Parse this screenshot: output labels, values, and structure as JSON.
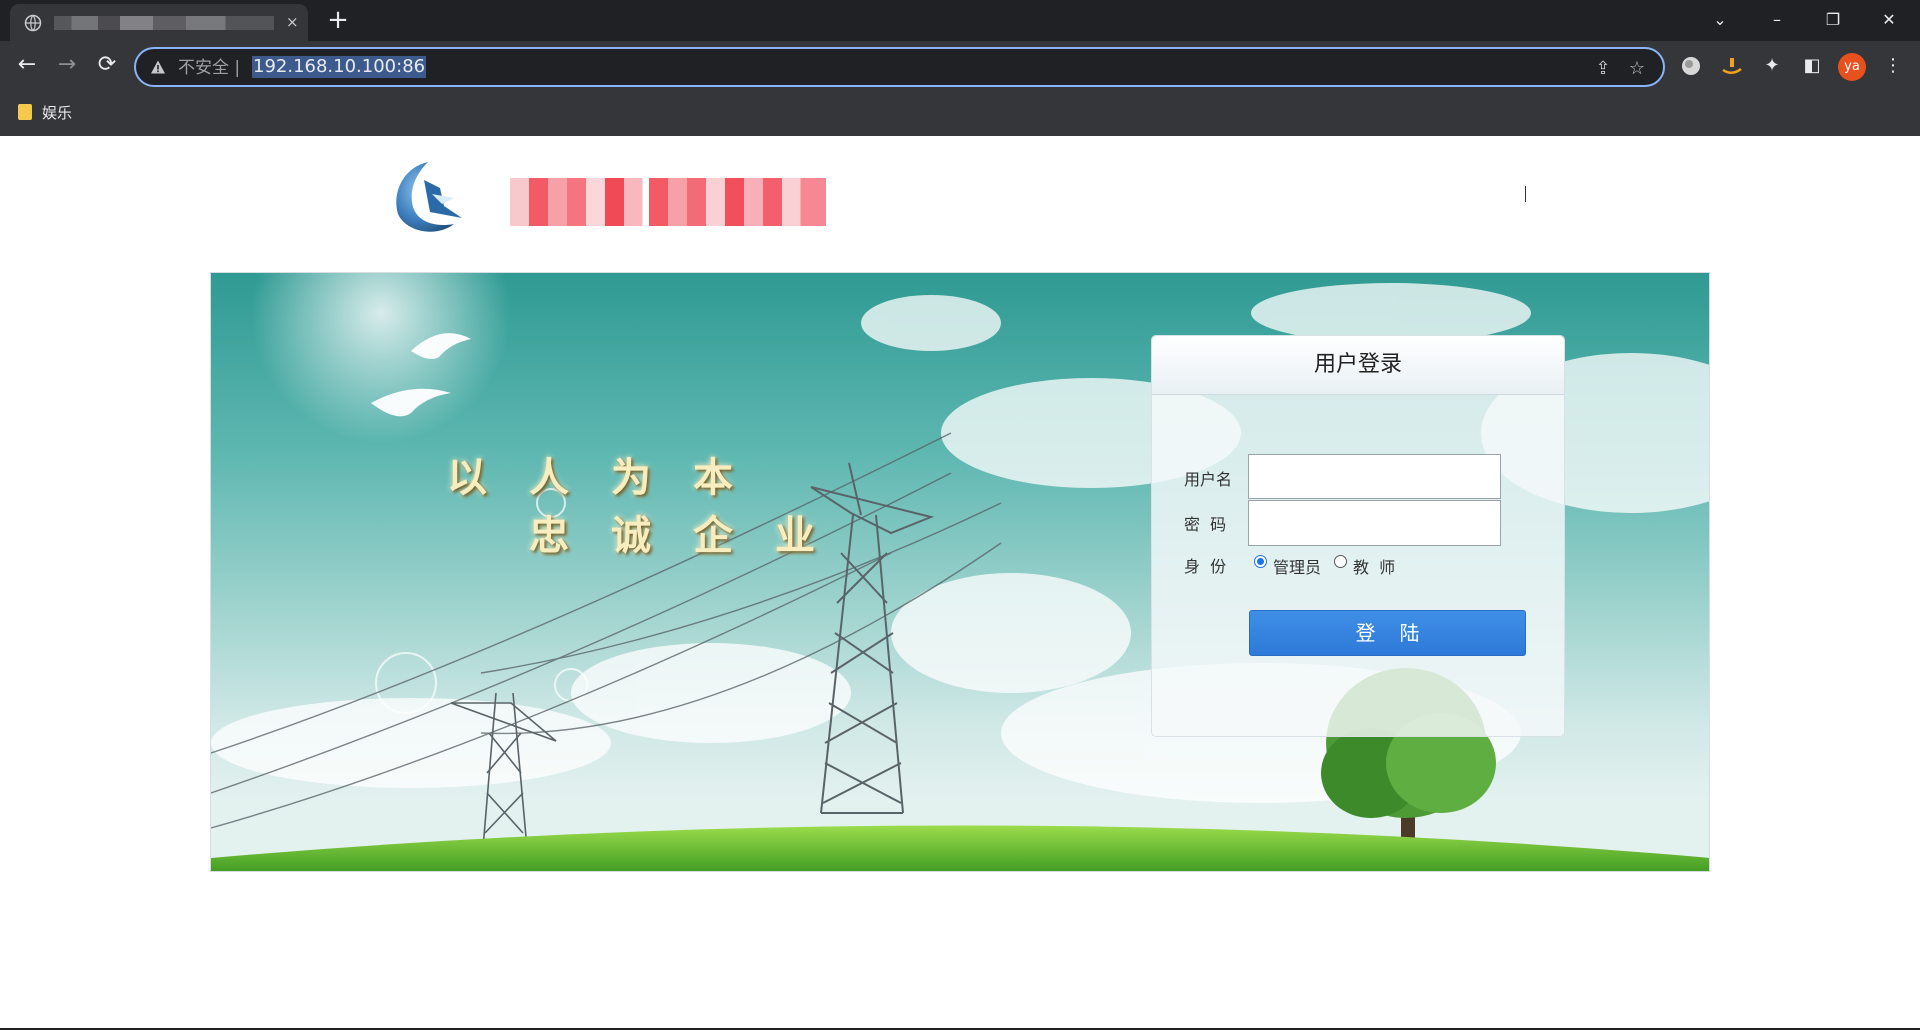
{
  "browser": {
    "tab_close": "×",
    "new_tab": "+",
    "window": {
      "tab_search": "⌄",
      "minimize": "–",
      "restore": "❐",
      "close": "✕"
    },
    "nav": {
      "back": "←",
      "forward": "→",
      "reload": "⟳"
    },
    "address": {
      "security_label": "不安全 |",
      "url": "192.168.10.100:86"
    },
    "omnibox_icons": {
      "share": "⇪",
      "star": "☆"
    },
    "extensions": {
      "puzzle": "✦",
      "sidepanel": "◧",
      "menu": "⋮"
    },
    "profile_initials": "ya",
    "bookmarks": [
      {
        "label": "娱乐"
      }
    ]
  },
  "banner": {
    "slogan_line1": [
      "以",
      "人",
      "为",
      "本"
    ],
    "slogan_line2": [
      "忠",
      "诚",
      "企",
      "业"
    ]
  },
  "login": {
    "title": "用户登录",
    "username_label": "用户名",
    "username_value": "",
    "password_label": "密  码",
    "password_value": "",
    "role_label": "身  份",
    "roles": [
      {
        "label": "管理员",
        "selected": true
      },
      {
        "label": "教  师",
        "selected": false
      }
    ],
    "submit_label": "登陆"
  },
  "colors": {
    "chrome_dark": "#202124",
    "toolbar": "#35363a",
    "omnibox_focus": "#8ab4f8",
    "login_button": "#3584e4",
    "avatar": "#e8501e"
  }
}
